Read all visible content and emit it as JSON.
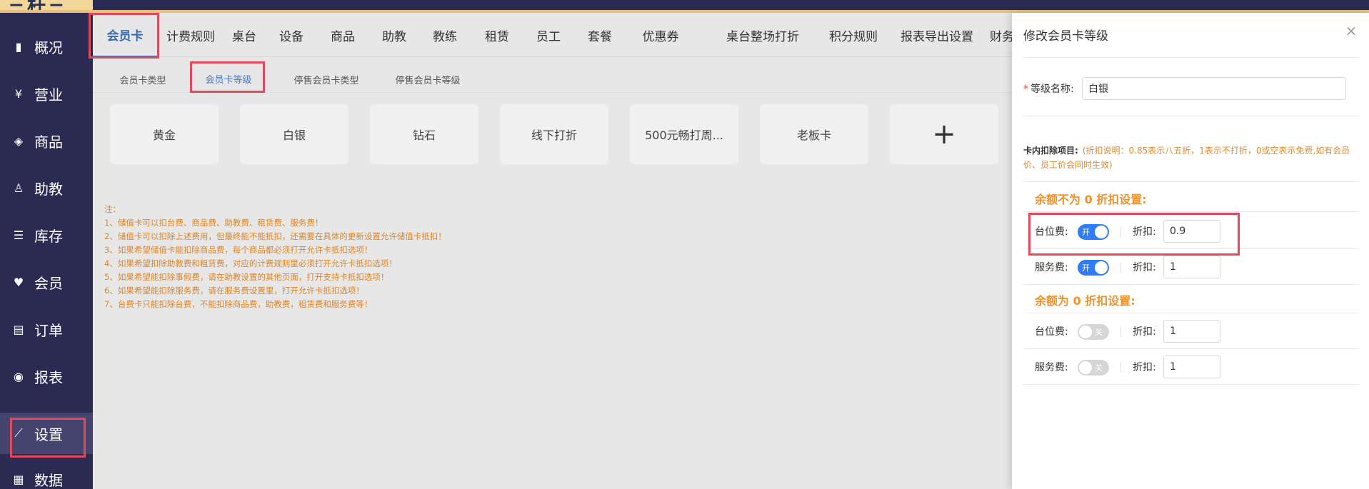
{
  "app": {
    "logo_text": "三杆三"
  },
  "sidebar": {
    "items": [
      {
        "label": "概况",
        "icon": "bar-chart-icon"
      },
      {
        "label": "营业",
        "icon": "yen-coin-icon"
      },
      {
        "label": "商品",
        "icon": "box-icon"
      },
      {
        "label": "助教",
        "icon": "person-icon"
      },
      {
        "label": "库存",
        "icon": "stack-icon"
      },
      {
        "label": "会员",
        "icon": "vip-icon"
      },
      {
        "label": "订单",
        "icon": "document-icon"
      },
      {
        "label": "报表",
        "icon": "report-icon"
      },
      {
        "label": "设置",
        "icon": "wrench-icon"
      },
      {
        "label": "数据",
        "icon": "data-icon"
      }
    ],
    "active_index": 8
  },
  "top_tabs": [
    "会员卡",
    "计费规则",
    "桌台",
    "设备",
    "商品",
    "助教",
    "教练",
    "租赁",
    "员工",
    "套餐",
    "优惠券",
    "桌台整场打折",
    "积分规则",
    "报表导出设置",
    "财务"
  ],
  "sub_tabs": [
    "会员卡类型",
    "会员卡等级",
    "停售会员卡类型",
    "停售会员卡等级"
  ],
  "cards": [
    "黄金",
    "白银",
    "钻石",
    "线下打折",
    "500元畅打周...",
    "老板卡"
  ],
  "add_card_symbol": "+",
  "notes": [
    "注：",
    "1、储值卡可以扣台费、商品费、助教费、租赁费、服务费！",
    "2、储值卡可以扣除上述费用，但最终能不能抵扣，还需要在具体的更新设置允许储值卡抵扣！",
    "3、如果希望储值卡能扣除商品费，每个商品都必须打开允许卡抵扣选项！",
    "4、如果希望扣除助教费和租赁费，对应的计费规则里必须打开允许卡抵扣选项！",
    "5、如果希望能扣除事假费，请在助教设置的其他页面，打开支持卡抵扣选项！",
    "6、如果希望能扣除服务费，请在服务费设置里，打开允许卡抵扣选项！",
    "7、台费卡只能扣除台费，不能扣除商品费，助教费，租赁费和服务费等！"
  ],
  "drawer": {
    "title": "修改会员卡等级",
    "close_symbol": "×",
    "level_name_label": "等级名称:",
    "level_name_value": "白银",
    "deduct_title": "卡内扣除项目:",
    "deduct_desc": "(折扣说明：0.85表示八五折，1表示不打折，0或空表示免费,如有会员价、员工价会同时生效)",
    "section_nonzero": "余额不为 0 折扣设置:",
    "section_zero": "余额为 0 折扣设置:",
    "discount_label": "折扣:",
    "rows_nonzero": [
      {
        "label": "台位费:",
        "toggle": "开",
        "on": true,
        "discount": "0.9"
      },
      {
        "label": "服务费:",
        "toggle": "开",
        "on": true,
        "discount": "1"
      }
    ],
    "rows_zero": [
      {
        "label": "台位费:",
        "toggle": "关",
        "on": false,
        "discount": "1"
      },
      {
        "label": "服务费:",
        "toggle": "关",
        "on": false,
        "discount": "1"
      }
    ]
  },
  "colors": {
    "sidebar_bg": "#2b2a52",
    "accent_blue": "#3b6bb5",
    "toggle_on": "#2f7df6",
    "notes_orange": "#e0892a",
    "highlight_red": "#e24a5c"
  }
}
